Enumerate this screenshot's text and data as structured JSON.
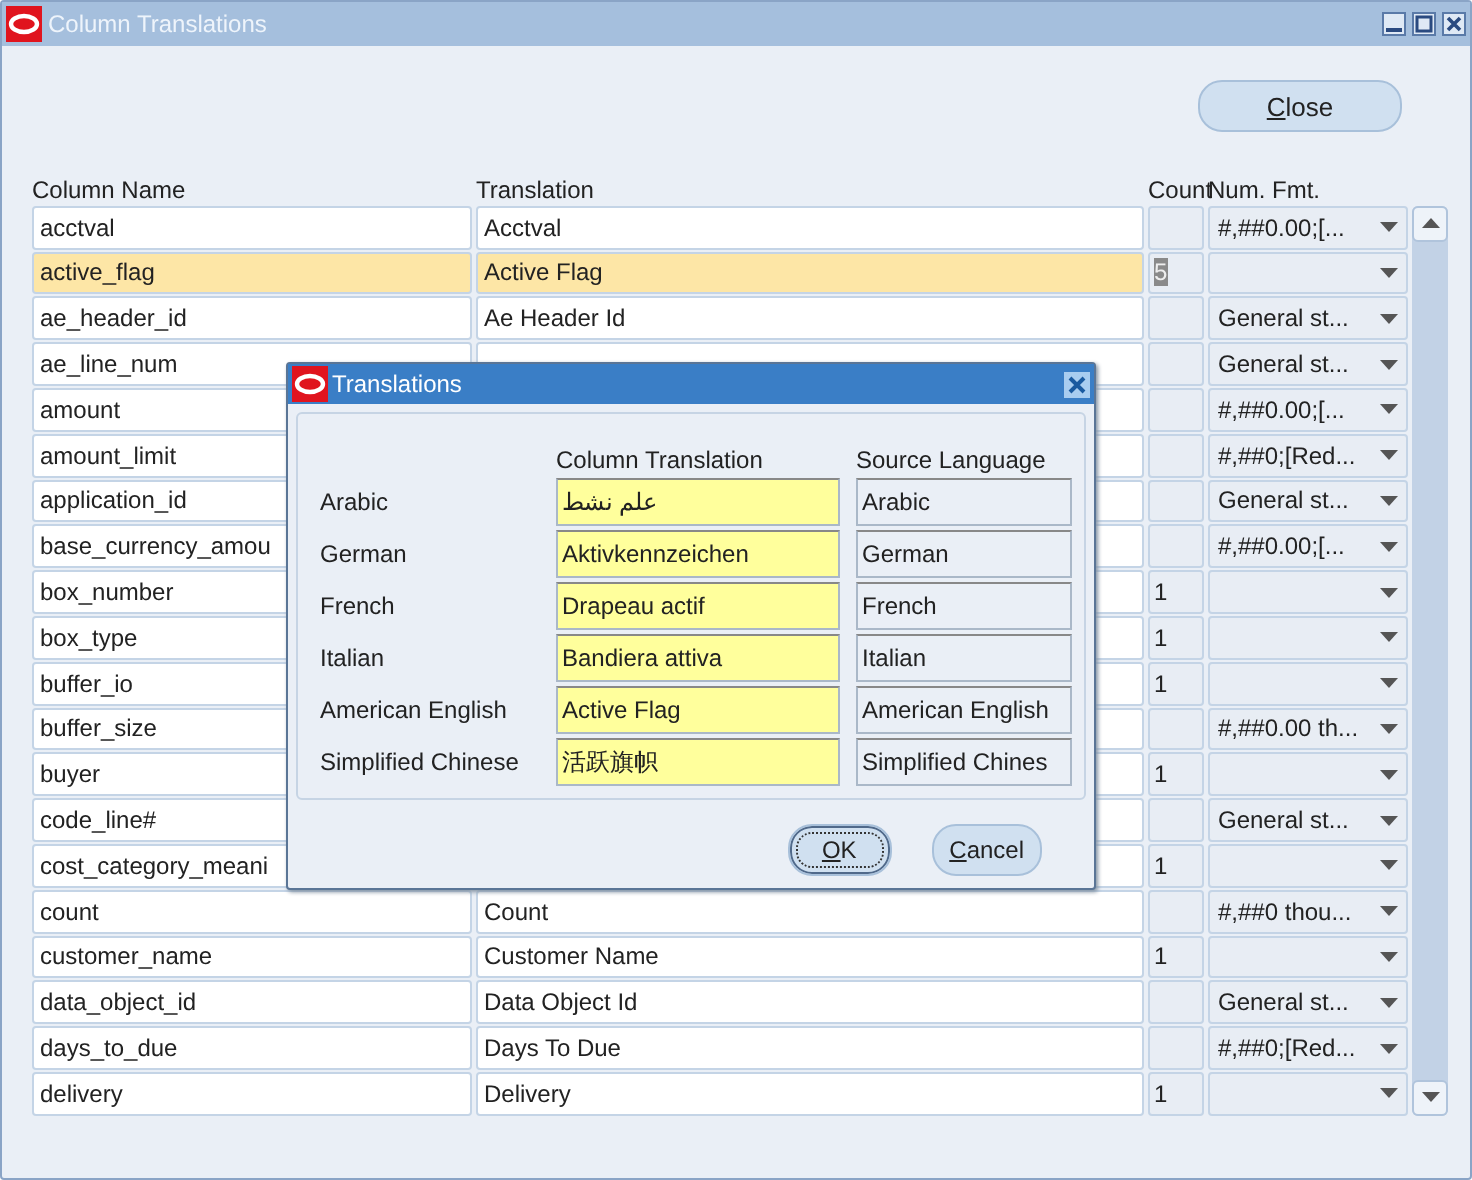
{
  "window": {
    "title": "Column Translations",
    "close_button": {
      "mnemonic": "C",
      "rest": "lose"
    }
  },
  "table": {
    "columns": [
      "Column Name",
      "Translation",
      "Count",
      "Num. Fmt."
    ],
    "rows": [
      {
        "name": "acctval",
        "translation": "Acctval",
        "count": "",
        "format": "#,##0.00;[...",
        "selected": false
      },
      {
        "name": "active_flag",
        "translation": "Active Flag",
        "count": "5",
        "format": "",
        "selected": true
      },
      {
        "name": "ae_header_id",
        "translation": "Ae Header Id",
        "count": "",
        "format": "General st...",
        "selected": false
      },
      {
        "name": "ae_line_num",
        "count": "",
        "format": "General st...",
        "selected": false
      },
      {
        "name": "amount",
        "count": "",
        "format": "#,##0.00;[...",
        "selected": false
      },
      {
        "name": "amount_limit",
        "count": "",
        "format": "#,##0;[Red...",
        "selected": false
      },
      {
        "name": "application_id",
        "count": "",
        "format": "General st...",
        "selected": false
      },
      {
        "name": "base_currency_amou",
        "count": "",
        "format": "#,##0.00;[...",
        "selected": false
      },
      {
        "name": "box_number",
        "count": "1",
        "format": "",
        "selected": false
      },
      {
        "name": "box_type",
        "count": "1",
        "format": "",
        "selected": false
      },
      {
        "name": "buffer_io",
        "count": "1",
        "format": "",
        "selected": false
      },
      {
        "name": "buffer_size",
        "count": "",
        "format": "#,##0.00 th...",
        "selected": false
      },
      {
        "name": "buyer",
        "count": "1",
        "format": "",
        "selected": false
      },
      {
        "name": "code_line#",
        "count": "",
        "format": "General st...",
        "selected": false
      },
      {
        "name": "cost_category_meani",
        "count": "1",
        "format": "",
        "selected": false
      },
      {
        "name": "count",
        "translation": "Count",
        "count": "",
        "format": "#,##0 thou...",
        "selected": false
      },
      {
        "name": "customer_name",
        "translation": "Customer Name",
        "count": "1",
        "format": "",
        "selected": false
      },
      {
        "name": "data_object_id",
        "translation": "Data Object Id",
        "count": "",
        "format": "General st...",
        "selected": false
      },
      {
        "name": "days_to_due",
        "translation": "Days To Due",
        "count": "",
        "format": "#,##0;[Red...",
        "selected": false
      },
      {
        "name": "delivery",
        "translation": "Delivery",
        "count": "1",
        "format": "",
        "selected": false
      }
    ]
  },
  "dialog": {
    "title": "Translations",
    "headers": [
      "Column Translation",
      "Source Language"
    ],
    "rows": [
      {
        "language": "Arabic",
        "translation": "علم نشط",
        "source": "Arabic"
      },
      {
        "language": "German",
        "translation": "Aktivkennzeichen",
        "source": "German"
      },
      {
        "language": "French",
        "translation": "Drapeau actif",
        "source": "French"
      },
      {
        "language": "Italian",
        "translation": "Bandiera attiva",
        "source": "Italian"
      },
      {
        "language": "American English",
        "translation": "Active Flag",
        "source": "American English"
      },
      {
        "language": "Simplified Chinese",
        "translation": "活跃旗帜",
        "source": "Simplified Chines"
      }
    ],
    "buttons": [
      {
        "mnemonic": "O",
        "rest": "K",
        "focused": true
      },
      {
        "mnemonic": "C",
        "rest": "ancel",
        "focused": false
      }
    ]
  }
}
